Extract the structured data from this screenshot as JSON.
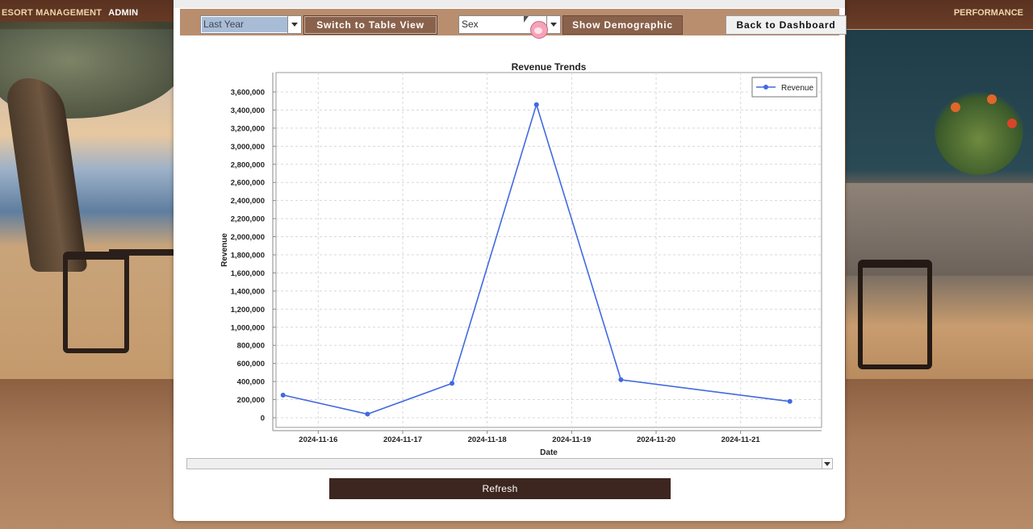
{
  "nav": {
    "left_title": "ESORT MANAGEMENT",
    "admin_link": "ADMIN",
    "right_link": "PERFORMANCE"
  },
  "controls": {
    "period_value": "Last Year",
    "switch_label": "Switch to Table View",
    "sex_value": "Sex",
    "demographic_label": "Show Demographic",
    "back_label": "Back to Dashboard"
  },
  "chart_data": {
    "type": "line",
    "title": "Revenue Trends",
    "xlabel": "Date",
    "ylabel": "Revenue",
    "x": [
      "2024-11-15T14:00",
      "2024-11-16T14:00",
      "2024-11-17T14:00",
      "2024-11-18T14:00",
      "2024-11-19T14:00",
      "2024-11-21T14:00"
    ],
    "series": [
      {
        "name": "Revenue",
        "values": [
          250000,
          40000,
          380000,
          3460000,
          420000,
          180000
        ]
      }
    ],
    "x_ticks": [
      "2024-11-16",
      "2024-11-17",
      "2024-11-18",
      "2024-11-19",
      "2024-11-20",
      "2024-11-21"
    ],
    "y_ticks": [
      "0",
      "200,000",
      "400,000",
      "600,000",
      "800,000",
      "1,000,000",
      "1,200,000",
      "1,400,000",
      "1,600,000",
      "1,800,000",
      "2,000,000",
      "2,200,000",
      "2,400,000",
      "2,600,000",
      "2,800,000",
      "3,000,000",
      "3,200,000",
      "3,400,000",
      "3,600,000"
    ],
    "ylim": [
      0,
      3600000
    ],
    "xlim": [
      "2024-11-15T12:00",
      "2024-11-21T23:00"
    ],
    "grid": true,
    "legend": "top-right",
    "color": "#4169e1"
  },
  "refresh_label": "Refresh"
}
